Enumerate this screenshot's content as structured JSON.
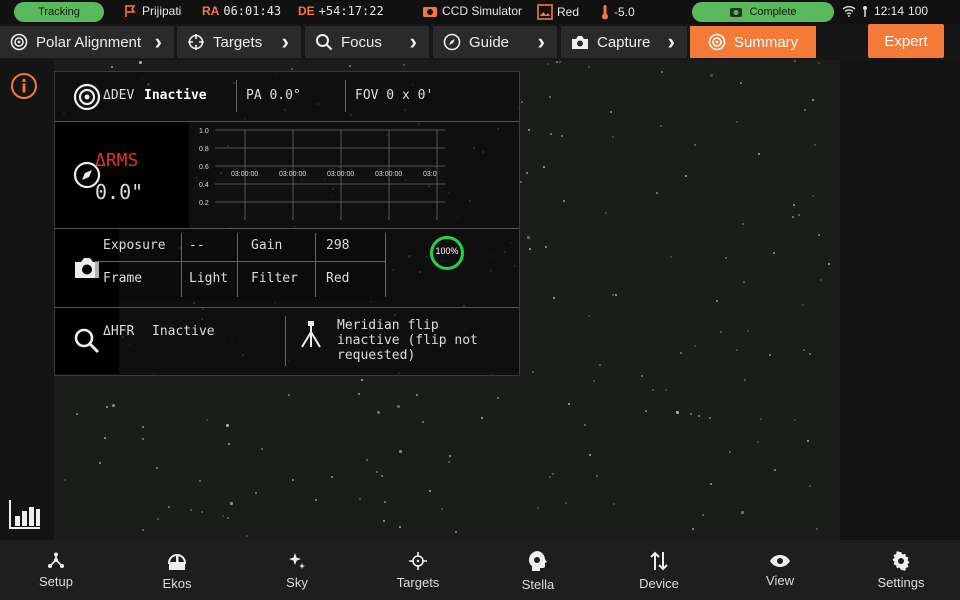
{
  "statusbar": {
    "tracking": "Tracking",
    "site": "Prijipati",
    "ra_label": "RA",
    "ra_value": "06:01:43",
    "de_label": "DE",
    "de_value": "+54:17:22",
    "camera": "CCD Simulator",
    "filter": "Red",
    "temperature": "-5.0",
    "status": "Complete",
    "clock": "12:14",
    "battery": "100"
  },
  "tabs": [
    {
      "label": "Polar Alignment",
      "icon": "target-icon"
    },
    {
      "label": "Targets",
      "icon": "crosshair-icon"
    },
    {
      "label": "Focus",
      "icon": "search-icon"
    },
    {
      "label": "Guide",
      "icon": "compass-icon"
    },
    {
      "label": "Capture",
      "icon": "camera-icon"
    },
    {
      "label": "Summary",
      "icon": "target-icon",
      "active": true
    }
  ],
  "expert_button": "Expert",
  "summary": {
    "dev_label": "ΔDEV",
    "dev_status": "Inactive",
    "pa": "PA 0.0°",
    "fov": "FOV 0 x 0'",
    "rms_label": "ΔRMS",
    "rms_value": "0.0\"",
    "graph_y_ticks": [
      "1.0",
      "0.8",
      "0.6",
      "0.4",
      "0.2"
    ],
    "graph_x_ticks": [
      "03:00:00",
      "03:00:00",
      "03:00:00",
      "03:00:00",
      "03:0"
    ],
    "exposure_label": "Exposure",
    "exposure_value": "--",
    "gain_label": "Gain",
    "gain_value": "298",
    "frame_label": "Frame",
    "frame_value": "Light",
    "filter_label": "Filter",
    "filter_value": "Red",
    "progress_label": "100%",
    "progress_value": 1.0,
    "hfr_label": "ΔHFR",
    "hfr_status": "Inactive",
    "meridian_text_1": "Meridian flip",
    "meridian_text_2": "inactive (flip not",
    "meridian_text_3": "requested)"
  },
  "bottom_nav": [
    {
      "label": "Setup",
      "icon": "setup-icon"
    },
    {
      "label": "Ekos",
      "icon": "observatory-icon"
    },
    {
      "label": "Sky",
      "icon": "sparkle-icon"
    },
    {
      "label": "Targets",
      "icon": "crosshair-icon"
    },
    {
      "label": "Stella",
      "icon": "stella-icon"
    },
    {
      "label": "Device",
      "icon": "swap-vertical-icon"
    },
    {
      "label": "View",
      "icon": "eye-icon"
    },
    {
      "label": "Settings",
      "icon": "gear-icon"
    }
  ],
  "colors": {
    "accent": "#f47a3a",
    "status_green": "#5cb85c",
    "rms_red": "#e03030",
    "progress_green": "#22d34a"
  }
}
